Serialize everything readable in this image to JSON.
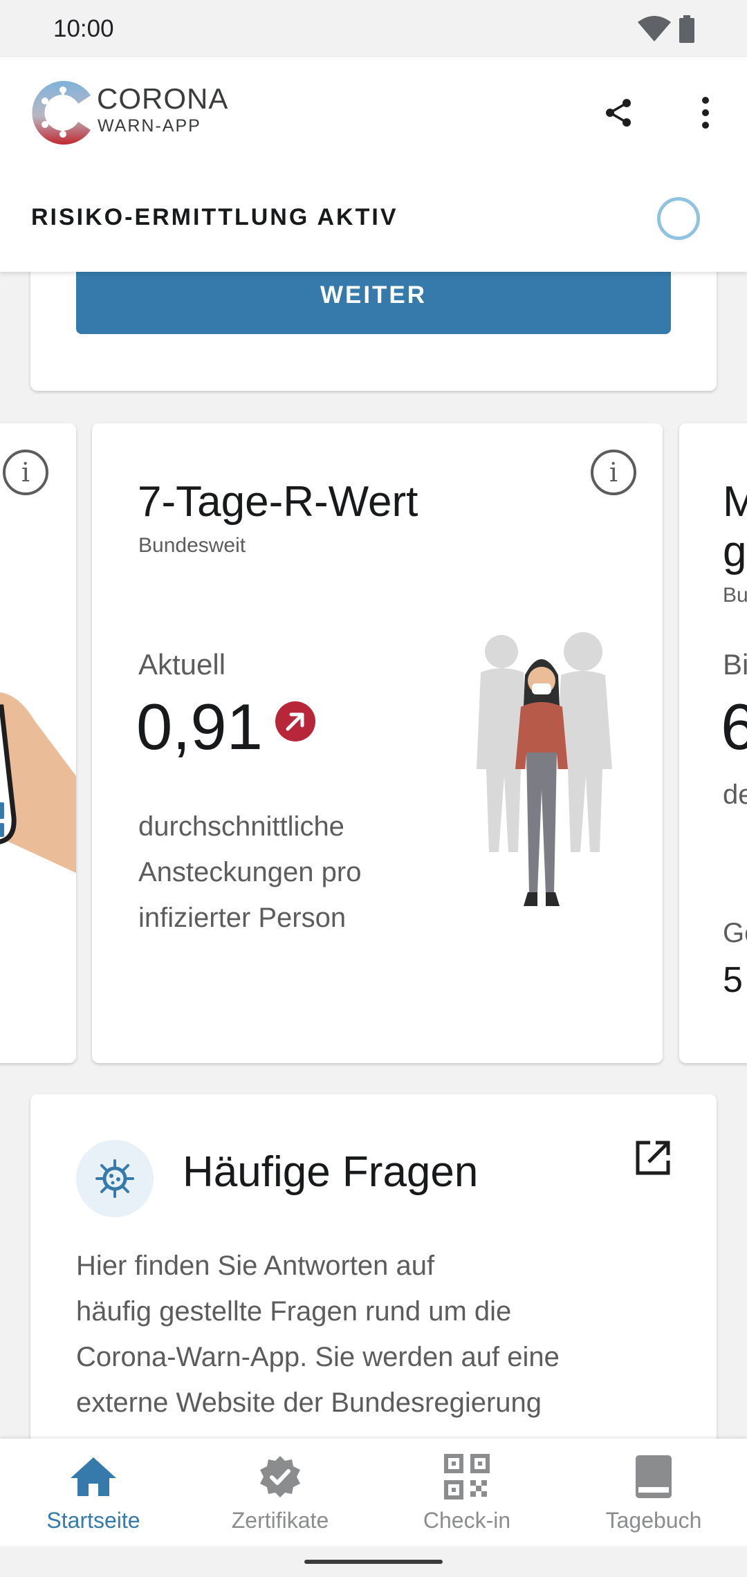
{
  "status_bar": {
    "time": "10:00"
  },
  "app_bar": {
    "logo_line1": "CORONA",
    "logo_line2": "WARN-APP",
    "risk_status": "RISIKO-ERMITTLUNG AKTIV"
  },
  "top_card": {
    "button_label": "WEITER"
  },
  "stat_card": {
    "title": "7-Tage-R-Wert",
    "subtitle": "Bundesweit",
    "label": "Aktuell",
    "value": "0,91",
    "trend": "increasing",
    "trend_color": "#b8263a",
    "description_lines": [
      "durchschnittliche",
      "Ansteckungen pro",
      "infizierter Person"
    ]
  },
  "next_card_fragment": {
    "line1": "M",
    "line2": "g",
    "line3": "Bu",
    "line4": "Bi",
    "line5": "6",
    "line6": "de",
    "line7": "Ge",
    "line8": "5"
  },
  "faq_card": {
    "title": "Häufige Fragen",
    "text_lines": [
      "Hier finden Sie Antworten auf",
      "häufig gestellte Fragen rund um die",
      "Corona-Warn-App. Sie werden auf eine",
      "externe Website der Bundesregierung"
    ]
  },
  "bottom_nav": {
    "items": [
      {
        "label": "Startseite",
        "icon": "home-icon",
        "active": true
      },
      {
        "label": "Zertifikate",
        "icon": "certificate-icon",
        "active": false
      },
      {
        "label": "Check-in",
        "icon": "qr-code-icon",
        "active": false
      },
      {
        "label": "Tagebuch",
        "icon": "diary-book-icon",
        "active": false
      }
    ]
  },
  "colors": {
    "accent": "#357aab",
    "trend_red": "#b8263a",
    "spinner": "#8fc3e0"
  }
}
